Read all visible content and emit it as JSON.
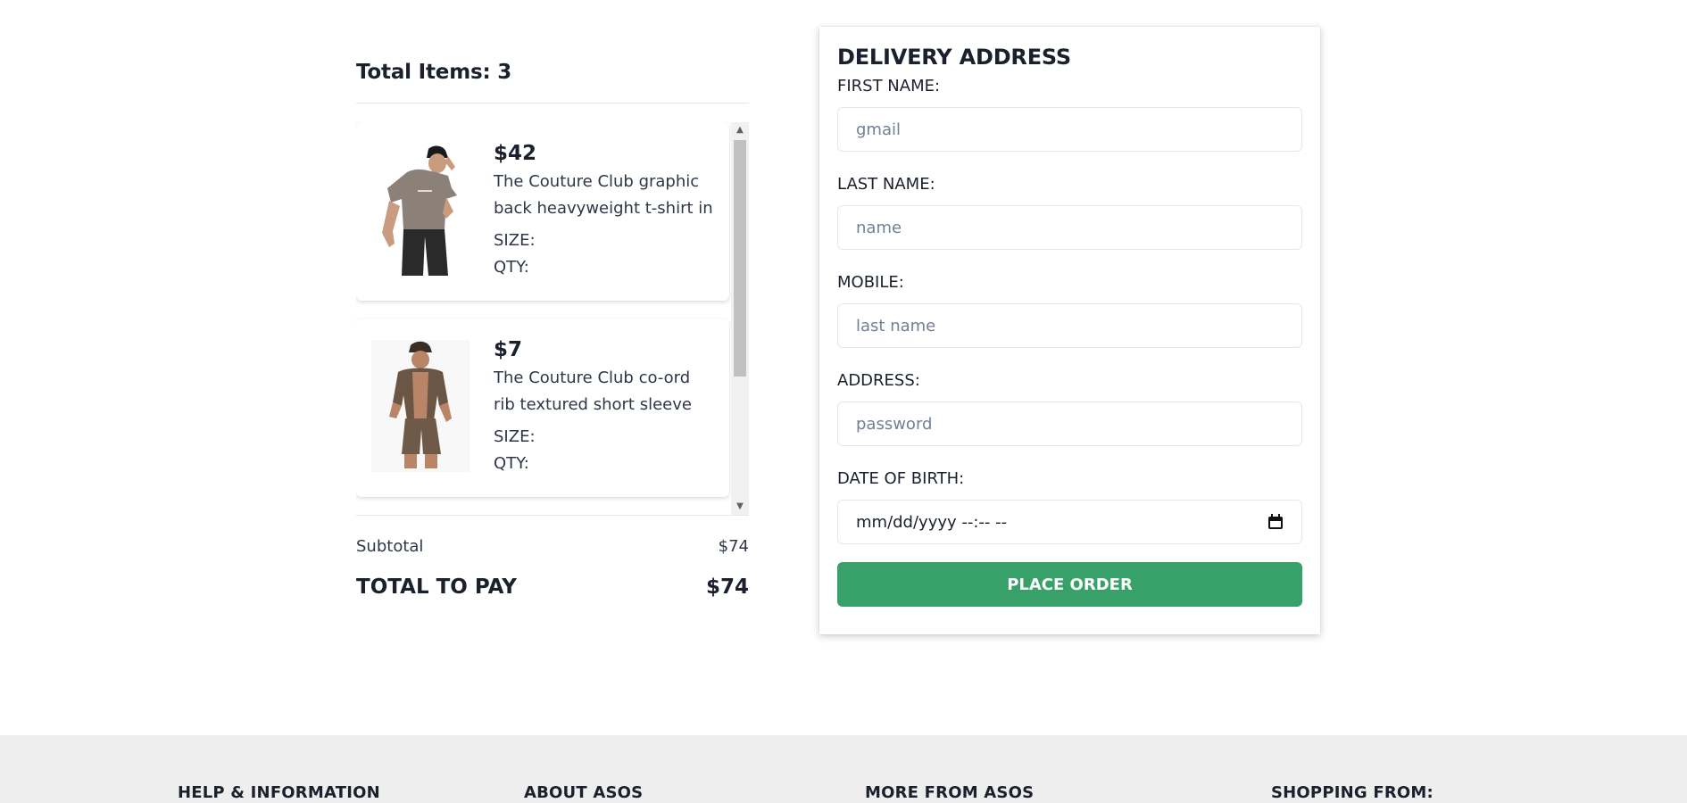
{
  "summary": {
    "total_items_label": "Total Items: 3",
    "items": [
      {
        "price": "$42",
        "name": "The Couture Club graphic back heavyweight t-shirt in taupe",
        "size_label": "SIZE:",
        "qty_label": "QTY:"
      },
      {
        "price": "$7",
        "name": "The Couture Club co-ord rib textured short sleeve shirt in brown",
        "size_label": "SIZE:",
        "qty_label": "QTY:"
      }
    ],
    "subtotal_label": "Subtotal",
    "subtotal_value": "$74",
    "total_label": "TOTAL TO PAY",
    "total_value": "$74"
  },
  "delivery": {
    "title": "DELIVERY ADDRESS",
    "first_name_label": "FIRST NAME:",
    "first_name_placeholder": "gmail",
    "last_name_label": "LAST NAME:",
    "last_name_placeholder": "name",
    "mobile_label": "MOBILE:",
    "mobile_placeholder": "last name",
    "address_label": "ADDRESS:",
    "address_placeholder": "password",
    "dob_label": "DATE OF BIRTH:",
    "dob_value": "mm/dd/yyyy --:-- --",
    "place_order_label": "PLACE ORDER"
  },
  "footer": {
    "headings": [
      "HELP & INFORMATION",
      "ABOUT ASOS",
      "MORE FROM ASOS",
      "SHOPPING FROM:"
    ]
  },
  "colors": {
    "place_order_bg": "#38a169",
    "footer_bg": "#eeeeee"
  },
  "icons": {
    "date_picker": "calendar-icon",
    "scroll_up": "scroll-up-arrow-icon",
    "scroll_down": "scroll-down-arrow-icon"
  }
}
